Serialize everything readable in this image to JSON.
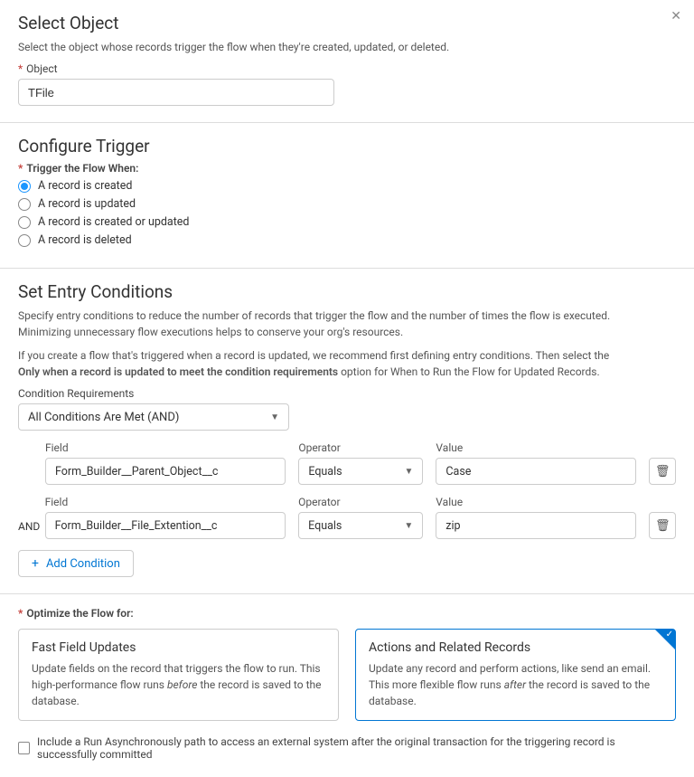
{
  "close": "✕",
  "sec1": {
    "title": "Select Object",
    "desc": "Select the object whose records trigger the flow when they're created, updated, or deleted.",
    "field_label": "Object",
    "value": "TFile"
  },
  "sec2": {
    "title": "Configure Trigger",
    "label": "Trigger the Flow When:",
    "options": [
      "A record is created",
      "A record is updated",
      "A record is created or updated",
      "A record is deleted"
    ],
    "selected": 0
  },
  "sec3": {
    "title": "Set Entry Conditions",
    "desc1": "Specify entry conditions to reduce the number of records that trigger the flow and the number of times the flow is executed. Minimizing unnecessary flow executions helps to conserve your org's resources.",
    "desc2a": "If you create a flow that's triggered when a record is updated, we recommend first defining entry conditions. Then select the ",
    "desc2b": "Only when a record is updated to meet the condition requirements",
    "desc2c": " option for When to Run the Flow for Updated Records.",
    "req_label": "Condition Requirements",
    "req_value": "All Conditions Are Met (AND)",
    "col_field": "Field",
    "col_operator": "Operator",
    "col_value": "Value",
    "rows": [
      {
        "logic": "",
        "field": "Form_Builder__Parent_Object__c",
        "operator": "Equals",
        "value": "Case"
      },
      {
        "logic": "AND",
        "field": "Form_Builder__File_Extention__c",
        "operator": "Equals",
        "value": "zip"
      }
    ],
    "add_label": "Add Condition"
  },
  "sec4": {
    "label": "Optimize the Flow for:",
    "options": [
      {
        "title": "Fast Field Updates",
        "desc1": "Update fields on the record that triggers the flow to run. This high-performance flow runs ",
        "em": "before",
        "desc2": " the record is saved to the database."
      },
      {
        "title": "Actions and Related Records",
        "desc1": "Update any record and perform actions, like send an email. This more flexible flow runs ",
        "em": "after",
        "desc2": " the record is saved to the database."
      }
    ],
    "selected": 1,
    "checkbox_label": "Include a Run Asynchronously path to access an external system after the original transaction for the triggering record is successfully committed"
  }
}
